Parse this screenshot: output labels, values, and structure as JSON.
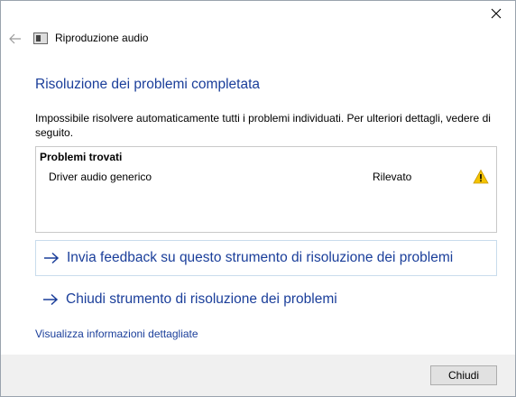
{
  "window": {
    "app_title": "Riproduzione audio",
    "title": "Risoluzione dei problemi completata",
    "description": "Impossibile risolvere automaticamente tutti i problemi individuati. Per ulteriori dettagli, vedere di seguito."
  },
  "problems": {
    "header": "Problemi trovati",
    "items": [
      {
        "name": "Driver audio generico",
        "status": "Rilevato",
        "icon": "warning-icon"
      }
    ]
  },
  "links": {
    "feedback": "Invia feedback su questo strumento di risoluzione dei problemi",
    "close_tool": "Chiudi strumento di risoluzione dei problemi",
    "details": "Visualizza informazioni dettagliate"
  },
  "footer": {
    "close_label": "Chiudi"
  },
  "colors": {
    "accent": "#1a3e9a",
    "warning": "#f5c400"
  }
}
